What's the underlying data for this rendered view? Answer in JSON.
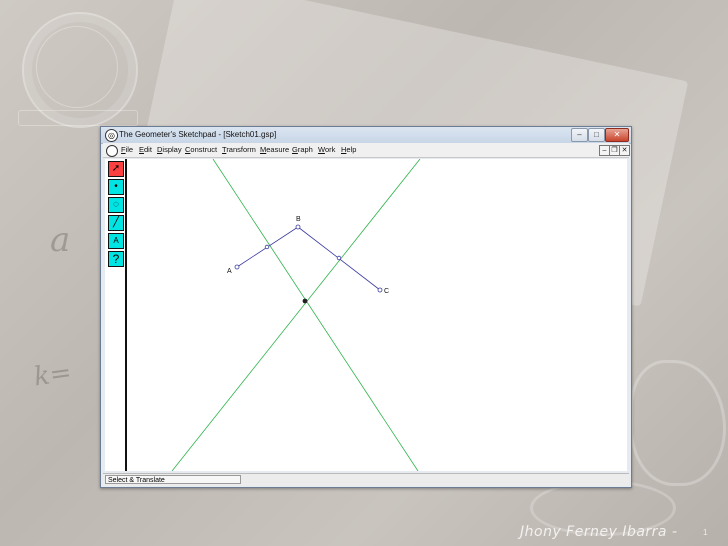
{
  "slide": {
    "footer_name": "Jhony Ferney Ibarra -",
    "page_number": "1",
    "background_math": [
      "a",
      "k="
    ]
  },
  "window": {
    "title": "The Geometer's Sketchpad - [Sketch01.gsp]",
    "app_icon": "sketchpad-compass-icon",
    "controls": [
      "minimize-icon",
      "maximize-icon",
      "close-icon"
    ],
    "doc_controls": [
      "minimize-icon",
      "restore-icon",
      "close-icon"
    ]
  },
  "menubar": {
    "items": [
      {
        "label": "File",
        "key": "F",
        "rest": "ile"
      },
      {
        "label": "Edit",
        "key": "E",
        "rest": "dit"
      },
      {
        "label": "Display",
        "key": "D",
        "rest": "isplay"
      },
      {
        "label": "Construct",
        "key": "C",
        "rest": "onstruct"
      },
      {
        "label": "Transform",
        "key": "T",
        "rest": "ransform"
      },
      {
        "label": "Measure",
        "key": "M",
        "rest": "easure"
      },
      {
        "label": "Graph",
        "key": "G",
        "rest": "raph"
      },
      {
        "label": "Work",
        "key": "W",
        "rest": "ork"
      },
      {
        "label": "Help",
        "key": "H",
        "rest": "elp"
      }
    ]
  },
  "toolbox": {
    "tools": [
      {
        "name": "arrow-select-icon",
        "glyph": "➚",
        "active": true
      },
      {
        "name": "point-tool-icon",
        "glyph": "•",
        "active": false
      },
      {
        "name": "compass-circle-tool-icon",
        "glyph": "◌",
        "active": false
      },
      {
        "name": "straightedge-tool-icon",
        "glyph": "╱",
        "active": false
      },
      {
        "name": "text-hand-tool-icon",
        "glyph": "A",
        "active": false
      },
      {
        "name": "help-tool-icon",
        "glyph": "?",
        "active": false
      }
    ],
    "active_color": "#ff4040",
    "tool_color": "#00e4e4"
  },
  "canvas": {
    "points": [
      {
        "label": "A"
      },
      {
        "label": "B"
      },
      {
        "label": "C"
      }
    ],
    "segment_color": "#3c3ca0",
    "bisector_color": "#2fb34a",
    "intersection_color": "#222222"
  },
  "statusbar": {
    "text": "Select & Translate"
  }
}
